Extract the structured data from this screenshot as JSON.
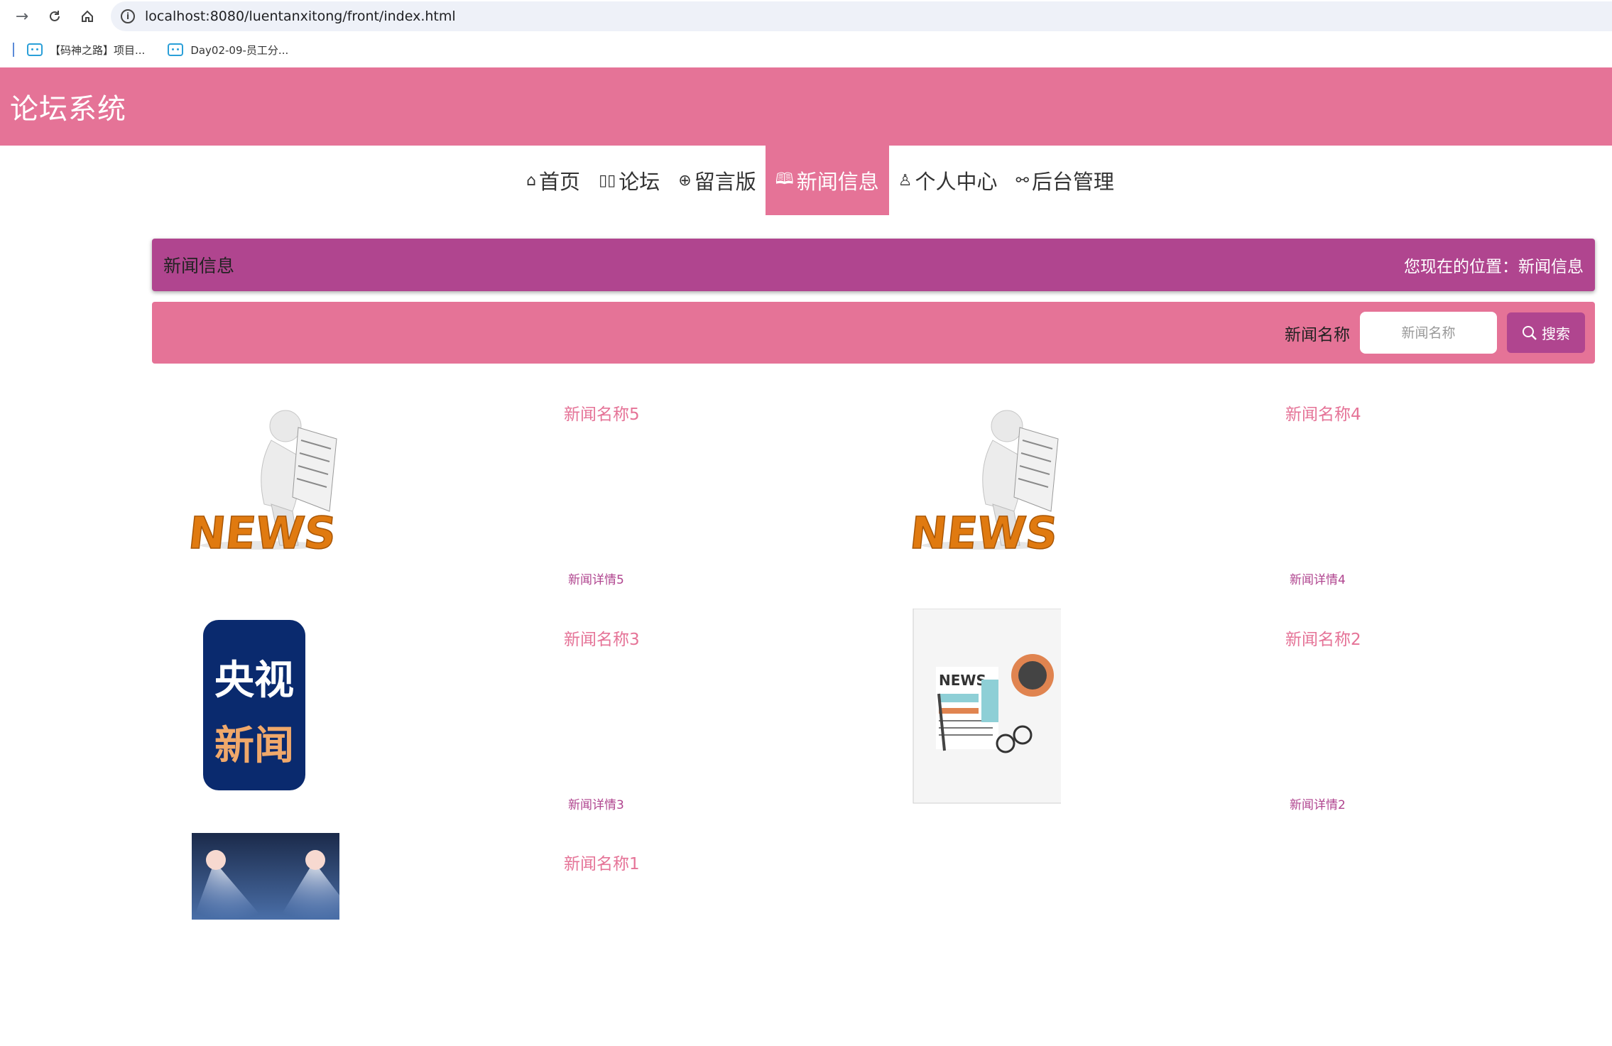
{
  "browser": {
    "url": "localhost:8080/luentanxitong/front/index.html",
    "bookmarks": [
      "【码神之路】项目...",
      "Day02-09-员工分..."
    ]
  },
  "site": {
    "title": "论坛系统"
  },
  "nav": {
    "items": [
      {
        "icon": "home-icon",
        "label": "首页"
      },
      {
        "icon": "columns-icon",
        "label": "论坛"
      },
      {
        "icon": "globe-icon",
        "label": "留言版"
      },
      {
        "icon": "book-icon",
        "label": "新闻信息"
      },
      {
        "icon": "user-icon",
        "label": "个人中心"
      },
      {
        "icon": "link-icon",
        "label": "后台管理"
      }
    ],
    "active": "新闻信息"
  },
  "breadcrumb": {
    "title": "新闻信息",
    "location": "您现在的位置：新闻信息"
  },
  "search": {
    "label": "新闻名称",
    "placeholder": "新闻名称",
    "button": "搜索"
  },
  "news": [
    {
      "name": "新闻名称5",
      "detail": "新闻详情5",
      "image": "news-man-icon"
    },
    {
      "name": "新闻名称4",
      "detail": "新闻详情4",
      "image": "news-man-icon"
    },
    {
      "name": "新闻名称3",
      "detail": "新闻详情3",
      "image": "cctv-news-logo",
      "logo_text": [
        "央视",
        "新闻"
      ]
    },
    {
      "name": "新闻名称2",
      "detail": "新闻详情2",
      "image": "newspaper-icon",
      "logo_text": [
        "NEWS"
      ]
    },
    {
      "name": "新闻名称1",
      "detail": "",
      "image": "stage-lights-image"
    }
  ],
  "colors": {
    "primary": "#e57397",
    "accent": "#b0458f"
  }
}
